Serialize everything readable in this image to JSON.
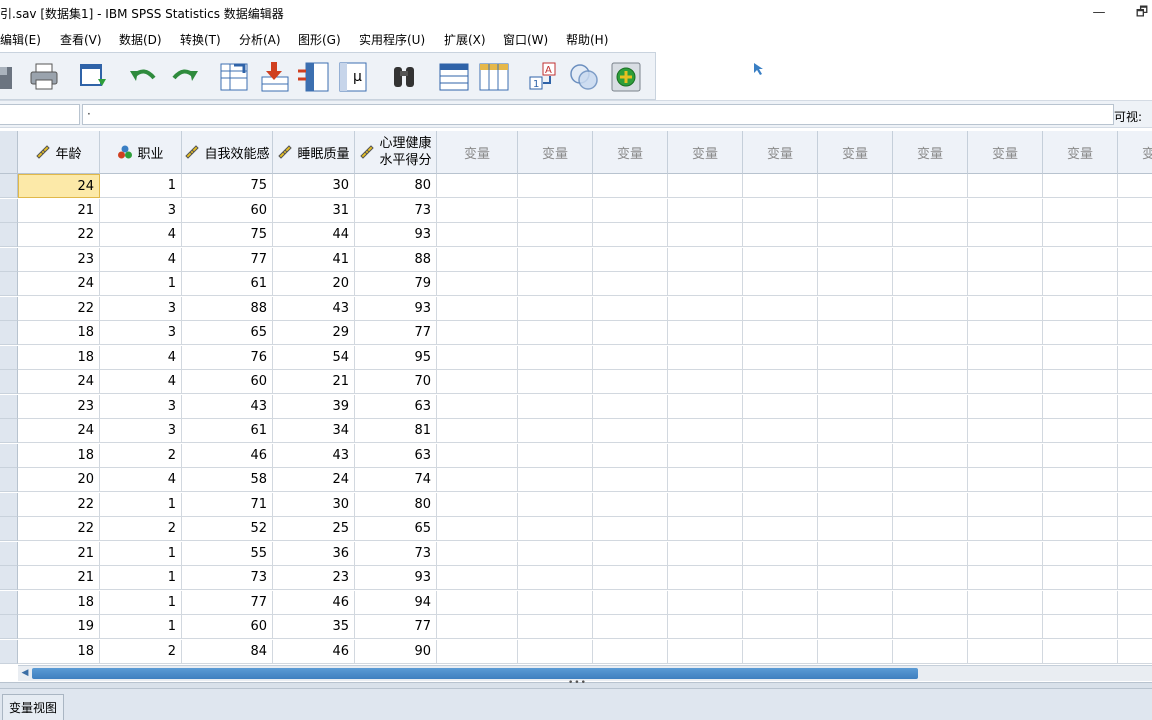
{
  "window": {
    "title": "引.sav [数据集1] - IBM SPSS Statistics 数据编辑器",
    "minimize_glyph": "—",
    "restore_glyph": "🗗"
  },
  "menu": [
    "编辑(E)",
    "查看(V)",
    "数据(D)",
    "转换(T)",
    "分析(A)",
    "图形(G)",
    "实用程序(U)",
    "扩展(X)",
    "窗口(W)",
    "帮助(H)"
  ],
  "toolbar": {
    "icons": [
      "save-icon",
      "print-icon",
      "recall-dialog-icon",
      "undo-icon",
      "redo-icon",
      "goto-case-icon",
      "goto-variable-icon",
      "variables-icon",
      "run-descriptives-icon",
      "find-icon",
      "insert-cases-icon",
      "insert-variable-icon",
      "split-file-icon",
      "value-labels-icon",
      "use-variable-sets-icon"
    ]
  },
  "editor": {
    "cell_ref": "",
    "cell_value": "·",
    "visible_label": "可视:"
  },
  "grid": {
    "columns": [
      {
        "label": "年龄",
        "icon": "scale-ruler-icon"
      },
      {
        "label": "职业",
        "icon": "nominal-icon"
      },
      {
        "label": "自我效能感",
        "icon": "scale-ruler-icon"
      },
      {
        "label": "睡眠质量",
        "icon": "scale-ruler-icon"
      },
      {
        "label_line1": "心理健康",
        "label_line2": "水平得分",
        "icon": "scale-ruler-icon"
      }
    ],
    "empty_column_label": "变量",
    "rows": [
      [
        24,
        1,
        75,
        30,
        80
      ],
      [
        21,
        3,
        60,
        31,
        73
      ],
      [
        22,
        4,
        75,
        44,
        93
      ],
      [
        23,
        4,
        77,
        41,
        88
      ],
      [
        24,
        1,
        61,
        20,
        79
      ],
      [
        22,
        3,
        88,
        43,
        93
      ],
      [
        18,
        3,
        65,
        29,
        77
      ],
      [
        18,
        4,
        76,
        54,
        95
      ],
      [
        24,
        4,
        60,
        21,
        70
      ],
      [
        23,
        3,
        43,
        39,
        63
      ],
      [
        24,
        3,
        61,
        34,
        81
      ],
      [
        18,
        2,
        46,
        43,
        63
      ],
      [
        20,
        4,
        58,
        24,
        74
      ],
      [
        22,
        1,
        71,
        30,
        80
      ],
      [
        22,
        2,
        52,
        25,
        65
      ],
      [
        21,
        1,
        55,
        36,
        73
      ],
      [
        21,
        1,
        73,
        23,
        93
      ],
      [
        18,
        1,
        77,
        46,
        94
      ],
      [
        19,
        1,
        60,
        35,
        77
      ],
      [
        18,
        2,
        84,
        46,
        90
      ]
    ],
    "selected_cell": {
      "row": 0,
      "col": 0
    }
  },
  "tabs": {
    "variable_view": "变量视图"
  },
  "colors": {
    "selected_cell": "#fce9a8",
    "header_bg": "#eef2f8",
    "scroll_thumb": "#4a8ccc"
  }
}
